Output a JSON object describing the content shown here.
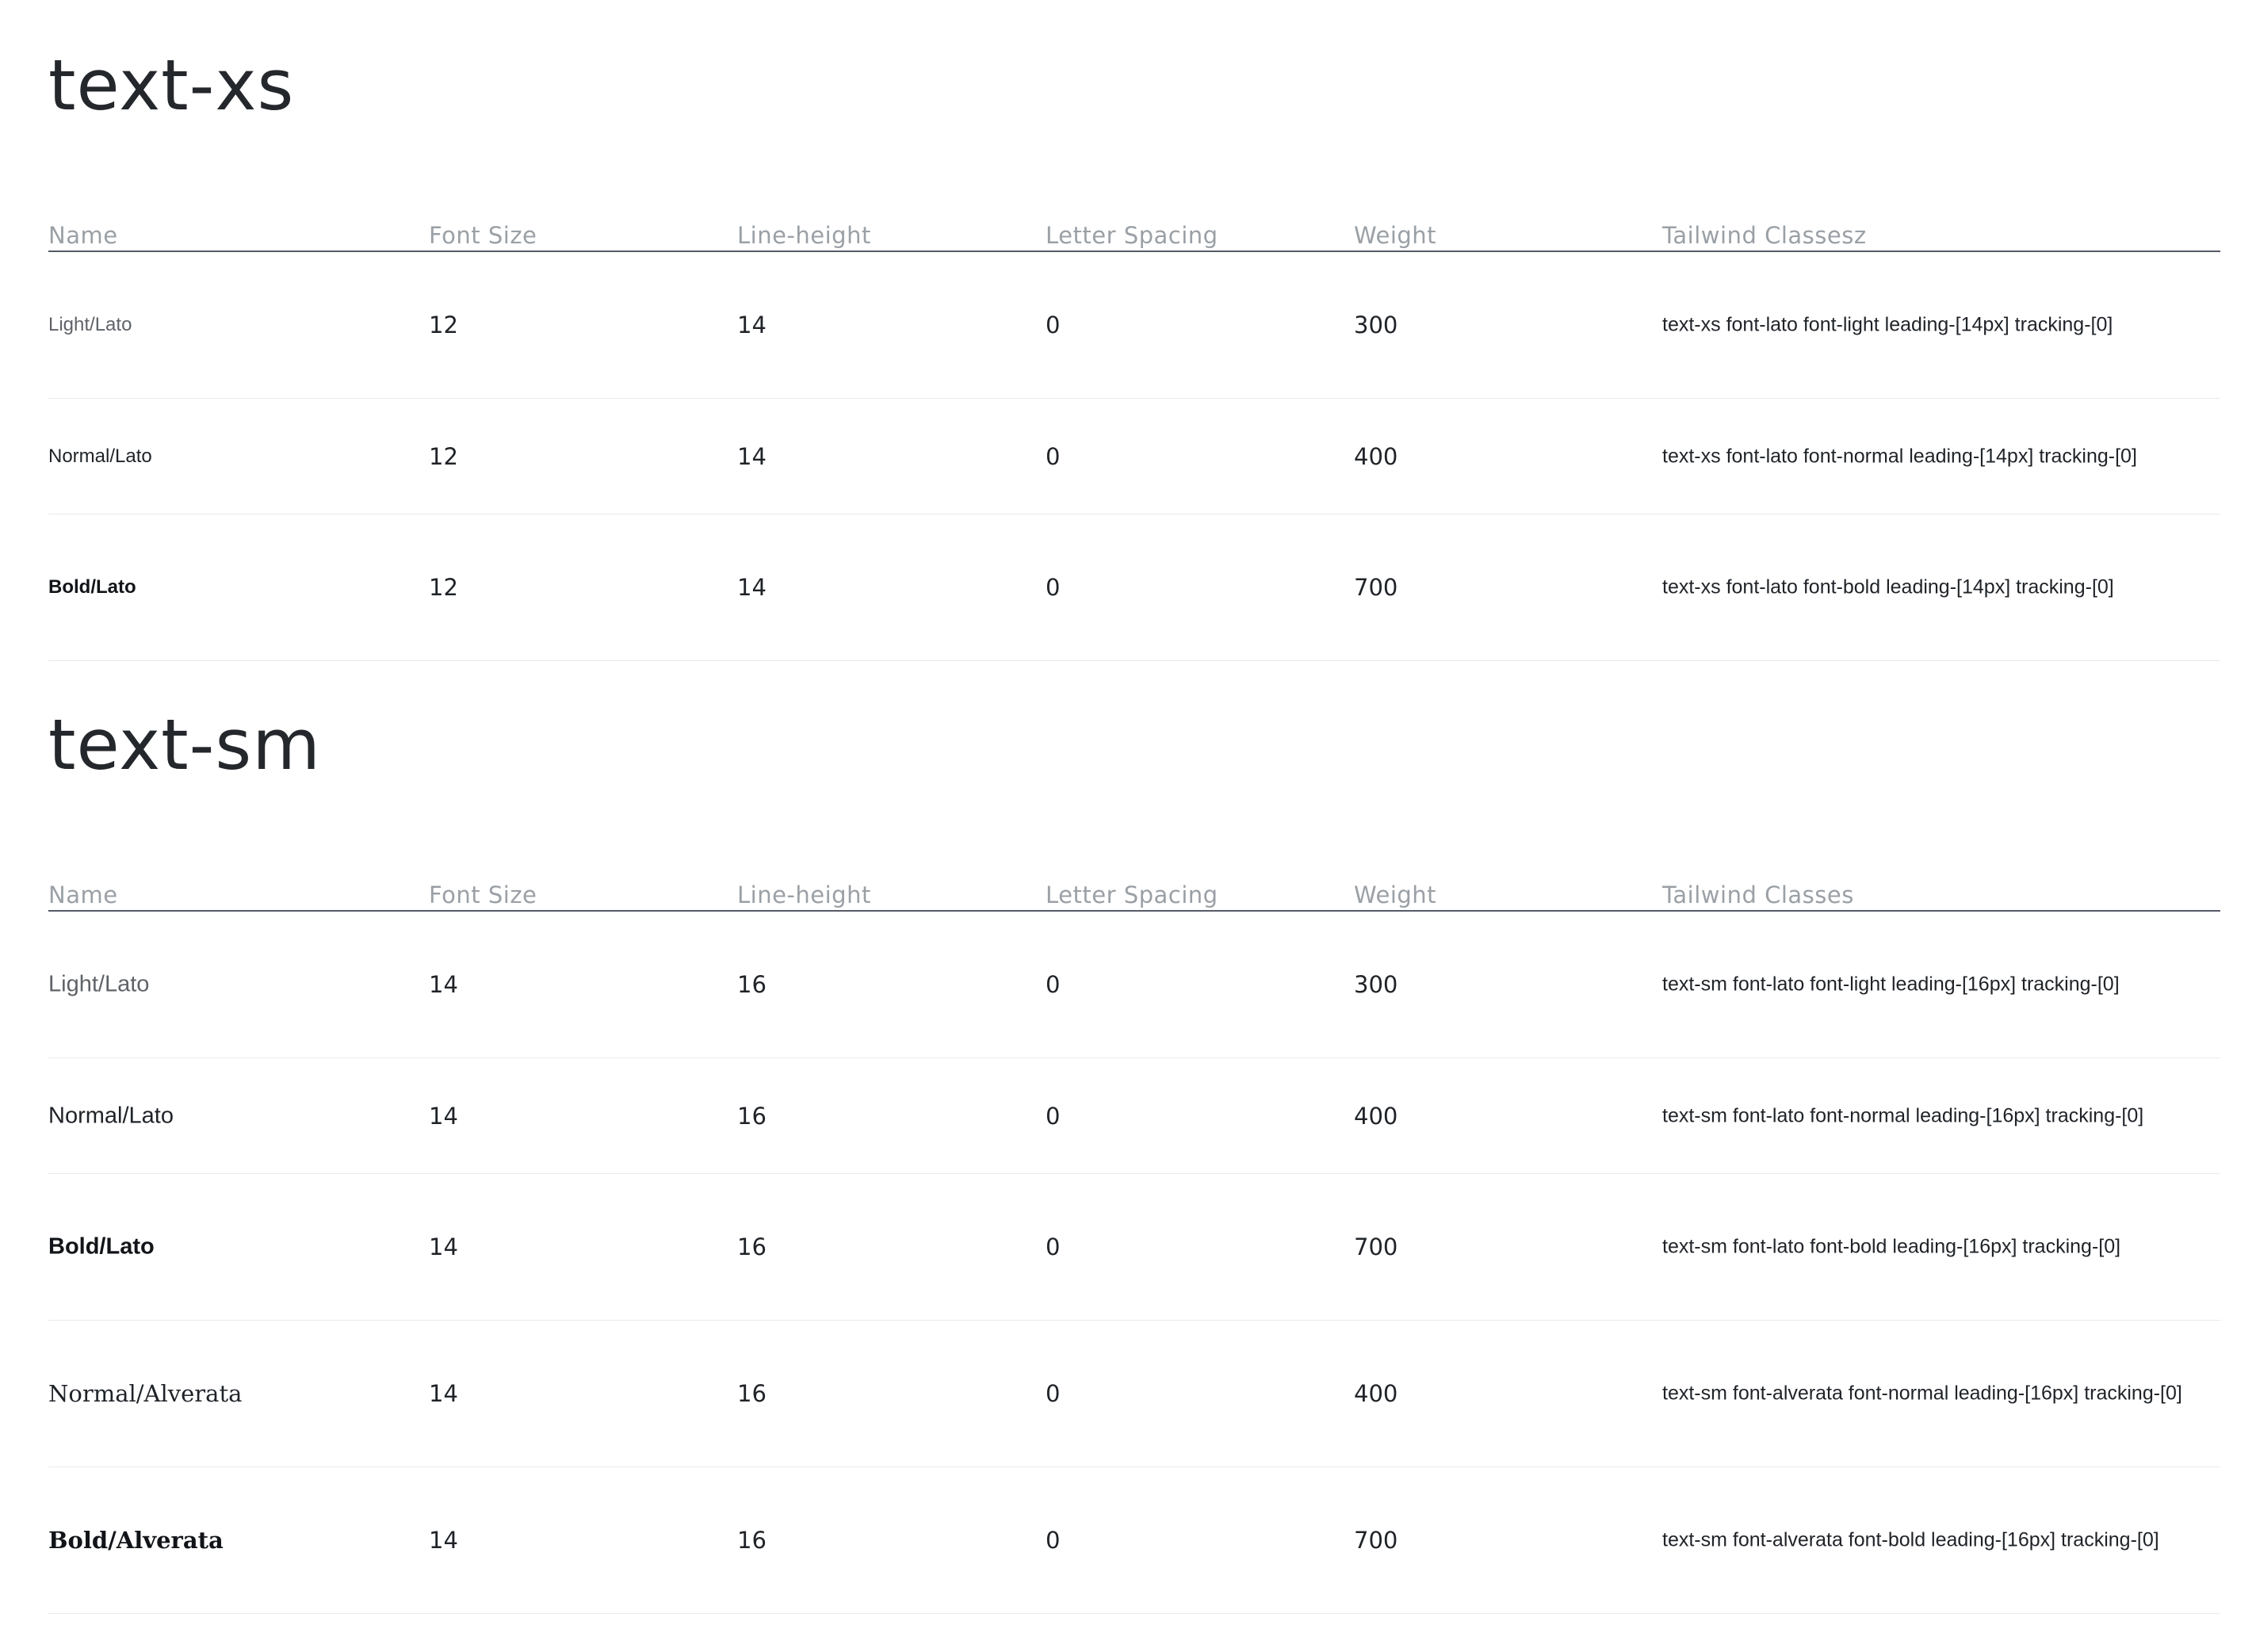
{
  "sections": [
    {
      "title": "text-xs",
      "headers": [
        "Name",
        "Font Size",
        "Line-height",
        "Letter Spacing",
        "Weight",
        "Tailwind Classesz"
      ],
      "rows": [
        {
          "name": "Light/Lato",
          "font_size": "12",
          "line_height": "14",
          "letter_spacing": "0",
          "weight": "300",
          "classes": "text-xs font-lato font-light leading-[14px] tracking-[0]"
        },
        {
          "name": "Normal/Lato",
          "font_size": "12",
          "line_height": "14",
          "letter_spacing": "0",
          "weight": "400",
          "classes": "text-xs font-lato font-normal leading-[14px] tracking-[0]"
        },
        {
          "name": "Bold/Lato",
          "font_size": "12",
          "line_height": "14",
          "letter_spacing": "0",
          "weight": "700",
          "classes": "text-xs font-lato font-bold leading-[14px] tracking-[0]"
        }
      ]
    },
    {
      "title": "text-sm",
      "headers": [
        "Name",
        "Font Size",
        "Line-height",
        "Letter Spacing",
        "Weight",
        "Tailwind Classes"
      ],
      "rows": [
        {
          "name": "Light/Lato",
          "font_size": "14",
          "line_height": "16",
          "letter_spacing": "0",
          "weight": "300",
          "classes": "text-sm font-lato font-light leading-[16px] tracking-[0]"
        },
        {
          "name": "Normal/Lato",
          "font_size": "14",
          "line_height": "16",
          "letter_spacing": "0",
          "weight": "400",
          "classes": "text-sm font-lato font-normal leading-[16px] tracking-[0]"
        },
        {
          "name": "Bold/Lato",
          "font_size": "14",
          "line_height": "16",
          "letter_spacing": "0",
          "weight": "700",
          "classes": "text-sm font-lato font-bold leading-[16px] tracking-[0]"
        },
        {
          "name": "Normal/Alverata",
          "font_size": "14",
          "line_height": "16",
          "letter_spacing": "0",
          "weight": "400",
          "classes": "text-sm font-alverata font-normal leading-[16px] tracking-[0]"
        },
        {
          "name": "Bold/Alverata",
          "font_size": "14",
          "line_height": "16",
          "letter_spacing": "0",
          "weight": "700",
          "classes": "text-sm font-alverata font-bold leading-[16px] tracking-[0]"
        }
      ]
    }
  ]
}
